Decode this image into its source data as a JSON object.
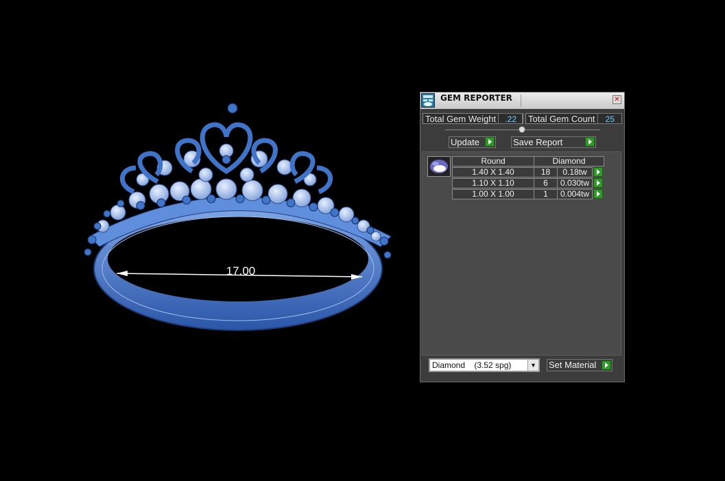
{
  "viewport": {
    "dimension_label": "17.00"
  },
  "panel": {
    "title": "GEM REPORTER",
    "close_glyph": "✕",
    "total_gem_weight": {
      "label": "Total Gem Weight",
      "value": ".22"
    },
    "total_gem_count": {
      "label": "Total Gem Count",
      "value": "25"
    },
    "update_label": "Update",
    "save_report_label": "Save Report",
    "table": {
      "shape": "Round",
      "material": "Diamond",
      "rows": [
        {
          "size": "1.40 X 1.40",
          "count": "18",
          "weight": "0.18tw"
        },
        {
          "size": "1.10 X 1.10",
          "count": "6",
          "weight": "0.030tw"
        },
        {
          "size": "1.00 X 1.00",
          "count": "1",
          "weight": "0.004tw"
        }
      ]
    },
    "material_select": {
      "name": "Diamond",
      "spg": "(3.52 spg)"
    },
    "set_material_label": "Set Material"
  },
  "colors": {
    "accent_green": "#2f9a28",
    "model_blue": "#3f74c8",
    "value_cyan": "#6fd0ff"
  }
}
